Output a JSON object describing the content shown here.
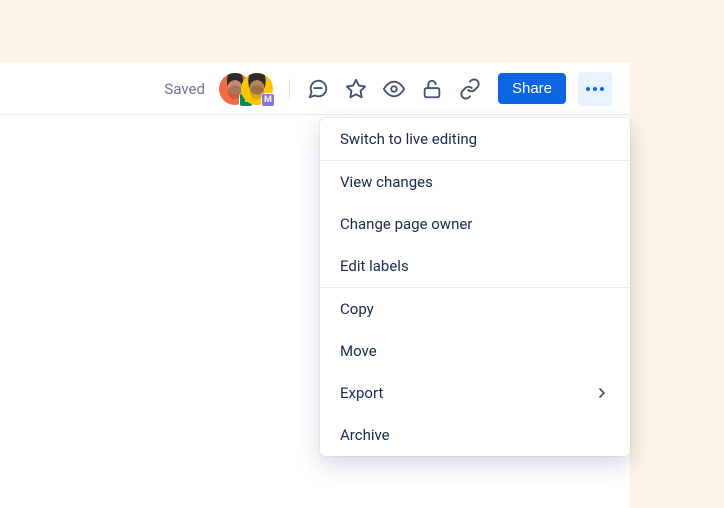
{
  "toolbar": {
    "saved_label": "Saved",
    "share_label": "Share",
    "avatars": [
      {
        "name": "avatar-1",
        "badge": "I",
        "badge_color": "green"
      },
      {
        "name": "avatar-2",
        "badge": "M",
        "badge_color": "purple"
      }
    ],
    "icons": [
      "comment",
      "star",
      "watch",
      "unlock",
      "link"
    ]
  },
  "menu": {
    "groups": [
      {
        "items": [
          {
            "label": "Switch to live editing"
          }
        ]
      },
      {
        "items": [
          {
            "label": "View changes"
          },
          {
            "label": "Change page owner"
          },
          {
            "label": "Edit labels"
          }
        ]
      },
      {
        "items": [
          {
            "label": "Copy"
          },
          {
            "label": "Move"
          },
          {
            "label": "Export",
            "has_submenu": true
          },
          {
            "label": "Archive"
          }
        ]
      }
    ]
  }
}
